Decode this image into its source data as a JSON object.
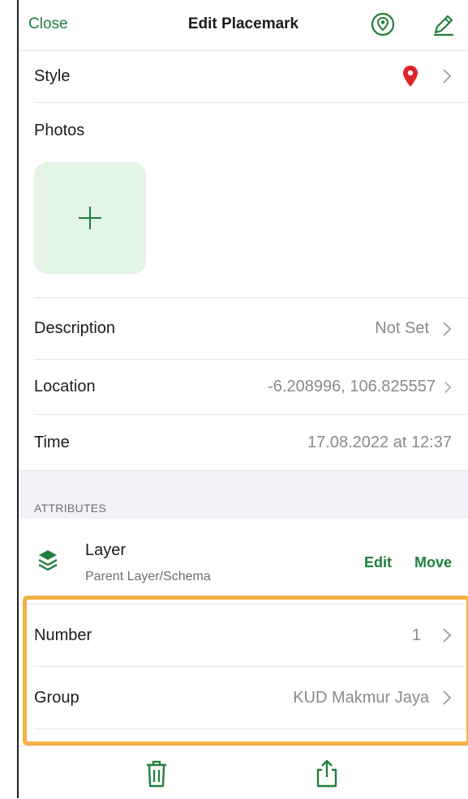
{
  "navbar": {
    "close_label": "Close",
    "title": "Edit Placemark",
    "locate_icon": "map-marker-circle-icon",
    "edit_icon": "pencil-icon"
  },
  "style_row": {
    "label": "Style",
    "marker_color": "#e0222a"
  },
  "photos": {
    "label": "Photos",
    "add_symbol": "+"
  },
  "description": {
    "label": "Description",
    "value": "Not Set"
  },
  "location": {
    "label": "Location",
    "value": "-6.208996, 106.825557"
  },
  "time": {
    "label": "Time",
    "value": "17.08.2022 at 12:37"
  },
  "attributes": {
    "header": "ATTRIBUTES"
  },
  "layer": {
    "title": "Layer",
    "subtitle": "Parent Layer/Schema",
    "edit_label": "Edit",
    "move_label": "Move"
  },
  "fields": [
    {
      "label": "Number",
      "value": "1"
    },
    {
      "label": "Group",
      "value": "KUD Makmur Jaya"
    }
  ],
  "toolbar": {
    "delete_icon": "trash-icon",
    "share_icon": "share-icon"
  },
  "colors": {
    "accent": "#1e7f3b",
    "highlight": "#f5b042",
    "photo_bg": "#e4f4e4"
  }
}
